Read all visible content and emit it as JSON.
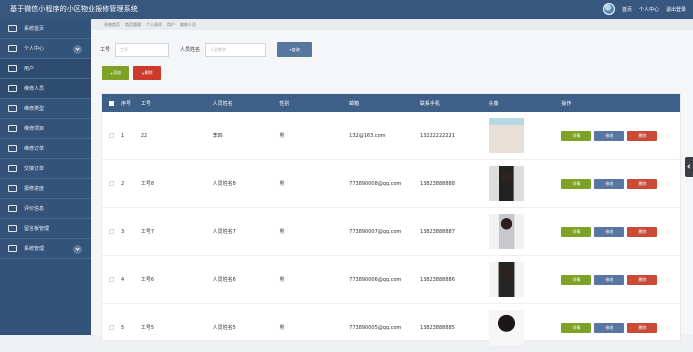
{
  "header": {
    "title": "基于微信小程序的小区物业报修管理系统",
    "home": "首页",
    "profile": "个人中心",
    "logout": "退出登录"
  },
  "sidebar": {
    "items": [
      {
        "label": "系统首页",
        "icon": "home-icon"
      },
      {
        "label": "个人中心",
        "icon": "user-icon"
      },
      {
        "label": "用户",
        "icon": "users-icon"
      },
      {
        "label": "维修人员",
        "icon": "repair-person-icon"
      },
      {
        "label": "维修类型",
        "icon": "category-icon"
      },
      {
        "label": "维修项目",
        "icon": "project-icon"
      },
      {
        "label": "维修订单",
        "icon": "order-icon"
      },
      {
        "label": "交接订单",
        "icon": "handover-icon"
      },
      {
        "label": "报修进度",
        "icon": "progress-icon"
      },
      {
        "label": "评价信息",
        "icon": "review-icon"
      },
      {
        "label": "留言板管理",
        "icon": "message-icon"
      },
      {
        "label": "系统管理",
        "icon": "settings-icon"
      }
    ]
  },
  "breadcrumb": [
    "系统首页",
    "首页管理",
    "个人选项",
    "用户",
    "维修人员"
  ],
  "search": {
    "label_id": "工号",
    "placeholder_id": "工号",
    "label_name": "人员姓名",
    "placeholder_name": "人员姓名",
    "query": "查询"
  },
  "actions": {
    "add": "添加",
    "delete": "删除"
  },
  "table": {
    "headers": [
      "序号",
      "工号",
      "人员姓名",
      "性别",
      "邮箱",
      "联系手机",
      "头像",
      "操作"
    ],
    "rows": [
      {
        "index": "1",
        "id": "22",
        "name": "李四",
        "gender": "男",
        "email": "132@163.com",
        "phone": "13222222221"
      },
      {
        "index": "2",
        "id": "工号8",
        "name": "人员姓名8",
        "gender": "男",
        "email": "773890008@qq.com",
        "phone": "13823888888"
      },
      {
        "index": "3",
        "id": "工号7",
        "name": "人员姓名7",
        "gender": "男",
        "email": "773890007@qq.com",
        "phone": "13823888887"
      },
      {
        "index": "4",
        "id": "工号6",
        "name": "人员姓名6",
        "gender": "男",
        "email": "773890006@qq.com",
        "phone": "13823888886"
      },
      {
        "index": "5",
        "id": "工号5",
        "name": "人员姓名5",
        "gender": "男",
        "email": "773890005@qq.com",
        "phone": "13823888885"
      }
    ],
    "buttons": {
      "detail": "详情",
      "edit": "修改",
      "delete": "删除"
    }
  }
}
